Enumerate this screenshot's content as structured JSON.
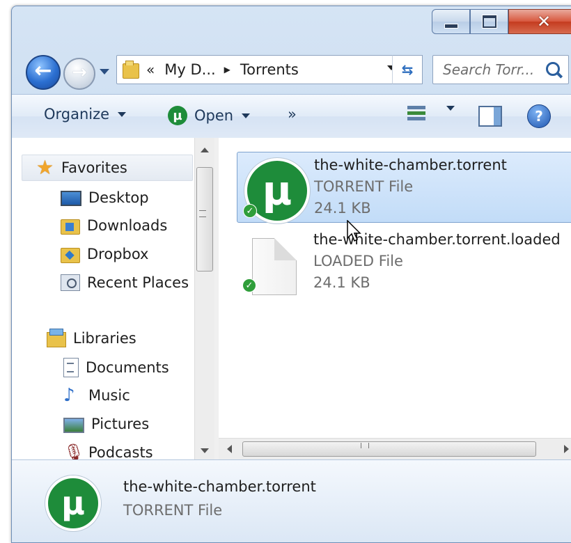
{
  "window": {
    "controls": {
      "minimize": "minimize",
      "maximize": "maximize",
      "close": "✕"
    }
  },
  "nav": {
    "address": {
      "overflow": "«",
      "crumb1": "My D...",
      "crumb2": "Torrents"
    },
    "search_placeholder": "Search Torr..."
  },
  "toolbar": {
    "organize_label": "Organize",
    "open_label": "Open",
    "more_label": "»"
  },
  "sidebar": {
    "favorites": {
      "label": "Favorites",
      "items": [
        {
          "label": "Desktop",
          "icon": "desktop-icon"
        },
        {
          "label": "Downloads",
          "icon": "downloads-folder-icon"
        },
        {
          "label": "Dropbox",
          "icon": "dropbox-folder-icon"
        },
        {
          "label": "Recent Places",
          "icon": "recent-places-icon"
        }
      ]
    },
    "libraries": {
      "label": "Libraries",
      "items": [
        {
          "label": "Documents",
          "icon": "documents-icon"
        },
        {
          "label": "Music",
          "icon": "music-icon"
        },
        {
          "label": "Pictures",
          "icon": "pictures-icon"
        },
        {
          "label": "Podcasts",
          "icon": "podcasts-icon"
        }
      ]
    }
  },
  "files": [
    {
      "name": "the-white-chamber.torrent",
      "type": "TORRENT File",
      "size": "24.1 KB",
      "selected": true,
      "icon": "utorrent-icon"
    },
    {
      "name": "the-white-chamber.torrent.loaded",
      "type": "LOADED File",
      "size": "24.1 KB",
      "selected": false,
      "icon": "blank-file-icon"
    }
  ],
  "details": {
    "name": "the-white-chamber.torrent",
    "type": "TORRENT File"
  },
  "colors": {
    "utorrent_green": "#1e8c3a",
    "selection": "#c2dcf8",
    "chrome": "#c4d8ef"
  }
}
